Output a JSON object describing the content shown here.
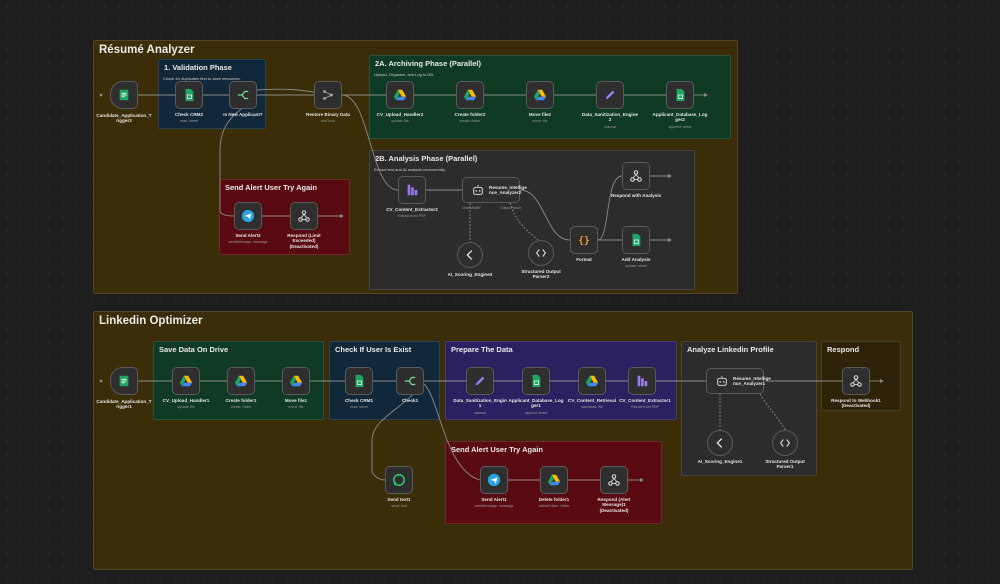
{
  "colors": {
    "canvas": "#1e1e1e",
    "workflow_frame": "#3a2d08",
    "phase_blue": "#11283a",
    "phase_green": "#0f3a24",
    "phase_dark": "#2c2c2c",
    "phase_red": "#5a0b12",
    "phase_purple": "#2b2160",
    "phase_brown": "#2e2208",
    "wire": "#8a8a8a",
    "sheets_green": "#1fa463",
    "drive_blue": "#4285f4",
    "drive_yellow": "#fbbc04",
    "telegram_blue": "#2aa4e0",
    "switch_green": "#7bd88f",
    "format_orange": "#f0a030",
    "edit_purple": "#9b7bf0"
  },
  "resume": {
    "title": "Résumé Analyzer",
    "validation": {
      "title": "1. Validation Phase",
      "subtitle": "Check for duplicates first to save resources."
    },
    "archiving": {
      "title": "2A. Archiving Phase (Parallel)",
      "subtitle": "Upload, Organize, and Log to DB."
    },
    "analysis": {
      "title": "2B. Analysis Phase (Parallel)",
      "subtitle": "Extract text and AI analysis concurrently."
    },
    "alert": {
      "title": "Send Alert User Try Again"
    },
    "nodes": {
      "trigger": {
        "label": "Candidate_Application_T\nrigger2",
        "icon": "form-icon"
      },
      "check_crm": {
        "label": "Check CRM2",
        "sub": "read: sheet",
        "icon": "sheets-icon"
      },
      "is_new": {
        "label": "Is New Applicant?",
        "icon": "switch-icon"
      },
      "restore": {
        "label": "Restore Binary Data",
        "sub": "runOnce",
        "icon": "merge-icon"
      },
      "cv_upload": {
        "label": "CV_Upload_Handler2",
        "sub": "upload: file",
        "icon": "drive-icon"
      },
      "create_folder": {
        "label": "Create folder2",
        "sub": "create: folder",
        "icon": "drive-icon"
      },
      "move_file": {
        "label": "Move file2",
        "sub": "move: file",
        "icon": "drive-icon"
      },
      "data_sanitization": {
        "label": "Data_Sanitization_Engine\n2",
        "sub": "manual",
        "icon": "pencil-icon"
      },
      "applicant_db_log": {
        "label": "Applicant_Database_Log\nger2",
        "sub": "append: sheet",
        "icon": "sheets-icon"
      },
      "cv_extractor": {
        "label": "CV_Content_Extractor2",
        "sub": "Extract from PDF",
        "icon": "extract-icon"
      },
      "analyzer": {
        "label": "Resume_Intellige\nnce_Analyzer2",
        "icon": "robot-icon"
      },
      "chat_model": {
        "label": "Chat Model",
        "tag": "Chat Model*",
        "icon": "chat-model-icon"
      },
      "output_parser": {
        "label": "Output Parser",
        "tag": "Output Parser"
      },
      "ai_scoring": {
        "label": "AI_Scoring_Engine3",
        "icon": "ai-icon"
      },
      "structured_parser": {
        "label": "Structured Output\nParser2",
        "icon": "brackets-icon"
      },
      "format": {
        "label": "Format",
        "icon": "curly-icon"
      },
      "respond_analysis": {
        "label": "Respond with Analysis",
        "icon": "webhook-icon"
      },
      "add_analysis": {
        "label": "Add Analysis",
        "sub": "update: sheet",
        "icon": "sheets-icon"
      },
      "send_alert": {
        "label": "Send Alert2",
        "sub": "sendMessage: message",
        "icon": "telegram-icon"
      },
      "respond_limit": {
        "label": "Respond (Limit\nExceeded)\n(Deactivated)",
        "icon": "webhook-icon"
      }
    }
  },
  "linkedin": {
    "title": "Linkedin Optimizer",
    "save": {
      "title": "Save Data On Drive"
    },
    "check": {
      "title": "Check If User Is Exist"
    },
    "prepare": {
      "title": "Prepare The Data"
    },
    "analyze": {
      "title": "Analyze Linkedin Profile"
    },
    "respond": {
      "title": "Respond"
    },
    "alert": {
      "title": "Send Alert User Try Again"
    },
    "nodes": {
      "trigger": {
        "label": "Candidate_Application_T\nrigger1",
        "icon": "form-icon"
      },
      "cv_upload": {
        "label": "CV_Upload_Handler1",
        "sub": "upload: file",
        "icon": "drive-icon"
      },
      "create_folder": {
        "label": "Create folder1",
        "sub": "create: folder",
        "icon": "drive-icon"
      },
      "move_file": {
        "label": "Move file1",
        "sub": "move: file",
        "icon": "drive-icon"
      },
      "check_crm": {
        "label": "Check CRM1",
        "sub": "read: sheet",
        "icon": "sheets-icon"
      },
      "check1": {
        "label": "Check1",
        "icon": "switch-icon"
      },
      "data_sanitization": {
        "label": "Data_Sanitization_Engin\n1",
        "sub": "manual",
        "icon": "pencil-icon"
      },
      "applicant_db_log": {
        "label": "Applicant_Database_Log\nger1",
        "sub": "append: sheet",
        "icon": "sheets-icon"
      },
      "cv_retrieval": {
        "label": "CV_Content_Retrieval",
        "sub": "download: file",
        "icon": "drive-icon"
      },
      "cv_extractor": {
        "label": "CV_Content_Extractor1",
        "sub": "Extract from PDF",
        "icon": "extract-icon"
      },
      "analyzer": {
        "label": "Resume_Intellige\nnce_Analyzer1",
        "icon": "robot-icon"
      },
      "ai_scoring": {
        "label": "AI_Scoring_Engine1",
        "icon": "ai-icon"
      },
      "structured_parser": {
        "label": "Structured Output\nParser1",
        "icon": "brackets-icon"
      },
      "respond_webhook": {
        "label": "Respond to Webhook1\n(Deactivated)",
        "icon": "webhook-icon"
      },
      "send_text": {
        "label": "Send text1",
        "sub": "send: text",
        "icon": "whatsapp-icon"
      },
      "send_alert": {
        "label": "Send Alert1",
        "sub": "sendMessage: message",
        "icon": "telegram-icon"
      },
      "delete_folder": {
        "label": "Delete folder1",
        "sub": "deleteFolder: folder",
        "icon": "drive-icon"
      },
      "respond_alert": {
        "label": "Respond (Alert\nMessage)1\n(Deactivated)",
        "icon": "webhook-icon"
      }
    }
  }
}
